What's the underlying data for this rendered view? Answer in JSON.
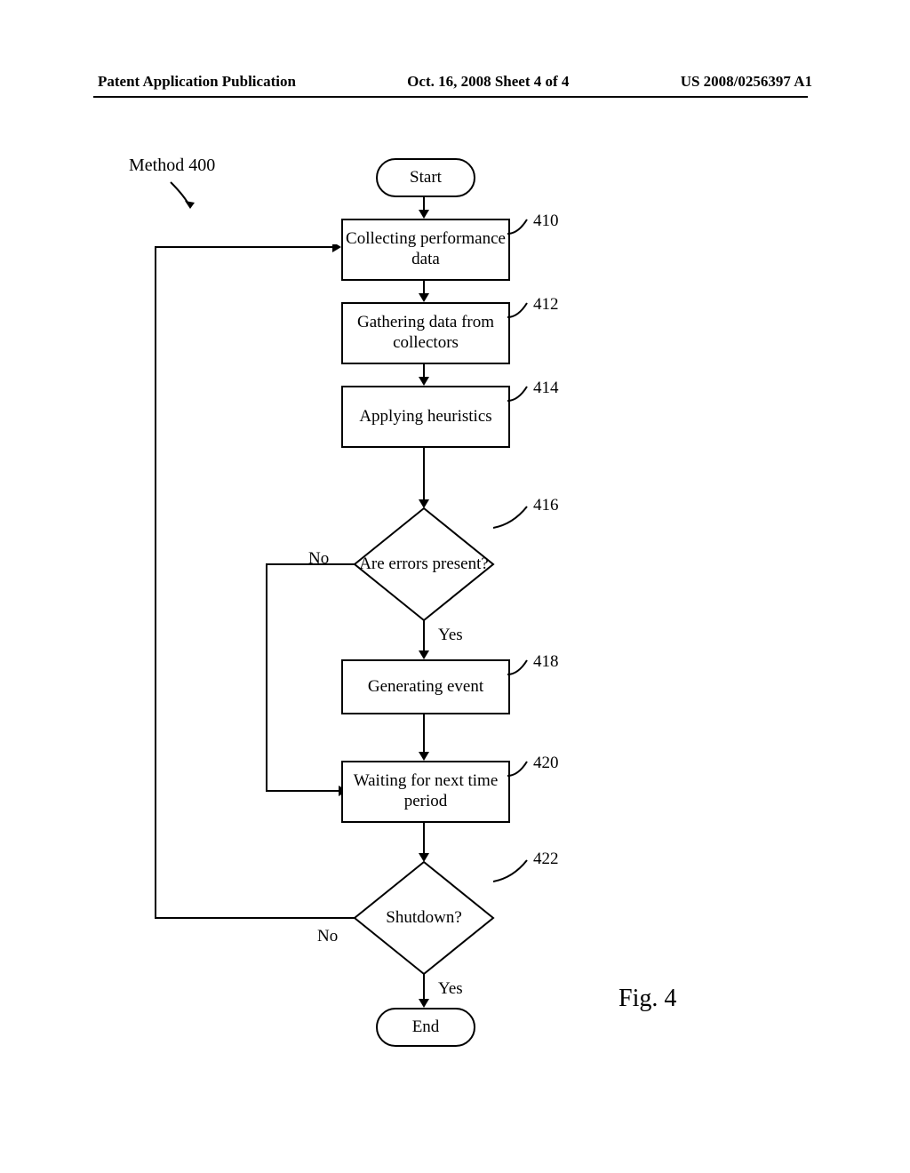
{
  "header": {
    "left": "Patent Application Publication",
    "center": "Oct. 16, 2008  Sheet 4 of 4",
    "right": "US 2008/0256397 A1"
  },
  "methodLabel": "Method 400",
  "start": "Start",
  "end": "End",
  "steps": {
    "s410": {
      "text": "Collecting performance data",
      "ref": "410"
    },
    "s412": {
      "text": "Gathering data from collectors",
      "ref": "412"
    },
    "s414": {
      "text": "Applying heuristics",
      "ref": "414"
    },
    "s416": {
      "text": "Are errors present?",
      "ref": "416"
    },
    "s418": {
      "text": "Generating event",
      "ref": "418"
    },
    "s420": {
      "text": "Waiting for next time period",
      "ref": "420"
    },
    "s422": {
      "text": "Shutdown?",
      "ref": "422"
    }
  },
  "branches": {
    "no416": "No",
    "yes416": "Yes",
    "no422": "No",
    "yes422": "Yes"
  },
  "figure": "Fig. 4"
}
